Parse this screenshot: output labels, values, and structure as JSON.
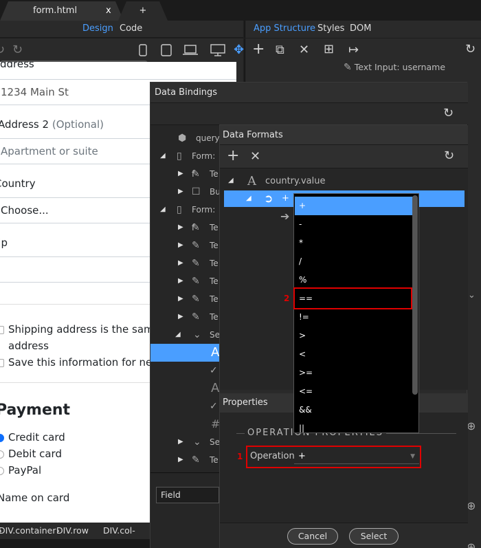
{
  "tabs": {
    "file_name": "form.html",
    "close_glyph": "x",
    "new_tab_glyph": "+"
  },
  "editor": {
    "modes": [
      "Design",
      "Code"
    ],
    "form": {
      "address_value": "1234 Main St",
      "address2_label": "Address 2",
      "address2_optional": "(Optional)",
      "address2_placeholder": "Apartment or suite",
      "country_label": "Country",
      "country_select": "Choose...",
      "zip_label": "Zip",
      "shipping_same_1": "Shipping address is the same",
      "shipping_same_2": "address",
      "save_info": "Save this information for next",
      "payment_heading": "Payment",
      "payment_methods": [
        "Credit card",
        "Debit card",
        "PayPal"
      ],
      "name_on_card_label": "Name on card"
    },
    "breadcrumb": [
      "DIV.container",
      "DIV.row",
      "DIV.col-md-"
    ]
  },
  "right_panel": {
    "tabs": [
      "App Structure",
      "Styles",
      "DOM"
    ],
    "tree_top_item": "Text Input: username"
  },
  "data_bindings": {
    "title": "Data Bindings",
    "tree": [
      {
        "text": "query",
        "icon": "cube-icon"
      },
      {
        "text": "Form: f",
        "icon": "form-icon"
      },
      {
        "text": "Te",
        "icon": "pencil-icon"
      },
      {
        "text": "Bu",
        "icon": "checkbox-icon"
      },
      {
        "text": "Form: f",
        "icon": "form-icon"
      },
      {
        "text": "Te",
        "icon": "pencil-icon"
      },
      {
        "text": "Te",
        "icon": "pencil-icon"
      },
      {
        "text": "Te",
        "icon": "pencil-icon"
      },
      {
        "text": "Te",
        "icon": "pencil-icon"
      },
      {
        "text": "Te",
        "icon": "pencil-icon"
      },
      {
        "text": "Te",
        "icon": "pencil-icon"
      },
      {
        "text": "Se",
        "icon": "chevron-icon"
      },
      {
        "text": "A",
        "icon": "text-icon"
      },
      {
        "text": "",
        "icon": "check-icon"
      },
      {
        "text": "A",
        "icon": "text-icon"
      },
      {
        "text": "",
        "icon": "check-icon"
      },
      {
        "text": "#",
        "icon": "hash-icon"
      },
      {
        "text": "Se",
        "icon": "chevron-icon"
      },
      {
        "text": "Te",
        "icon": "pencil-icon"
      }
    ],
    "field_select": "Field"
  },
  "data_formats": {
    "title": "Data Formats",
    "country_node": "country.value",
    "op_node": "+",
    "properties_title": "Properties",
    "section_title": "OPERATION PROPERTIES",
    "operation_label": "Operation",
    "operation_value": "+",
    "cancel_label": "Cancel",
    "select_label": "Select"
  },
  "operators": [
    "+",
    "-",
    "*",
    "/",
    "%",
    "==",
    "!=",
    ">",
    "<",
    ">=",
    "<=",
    "&&",
    "||"
  ],
  "callouts": [
    "1",
    "2"
  ],
  "colors": {
    "accent": "#4a9eff",
    "callout": "#e00000"
  }
}
